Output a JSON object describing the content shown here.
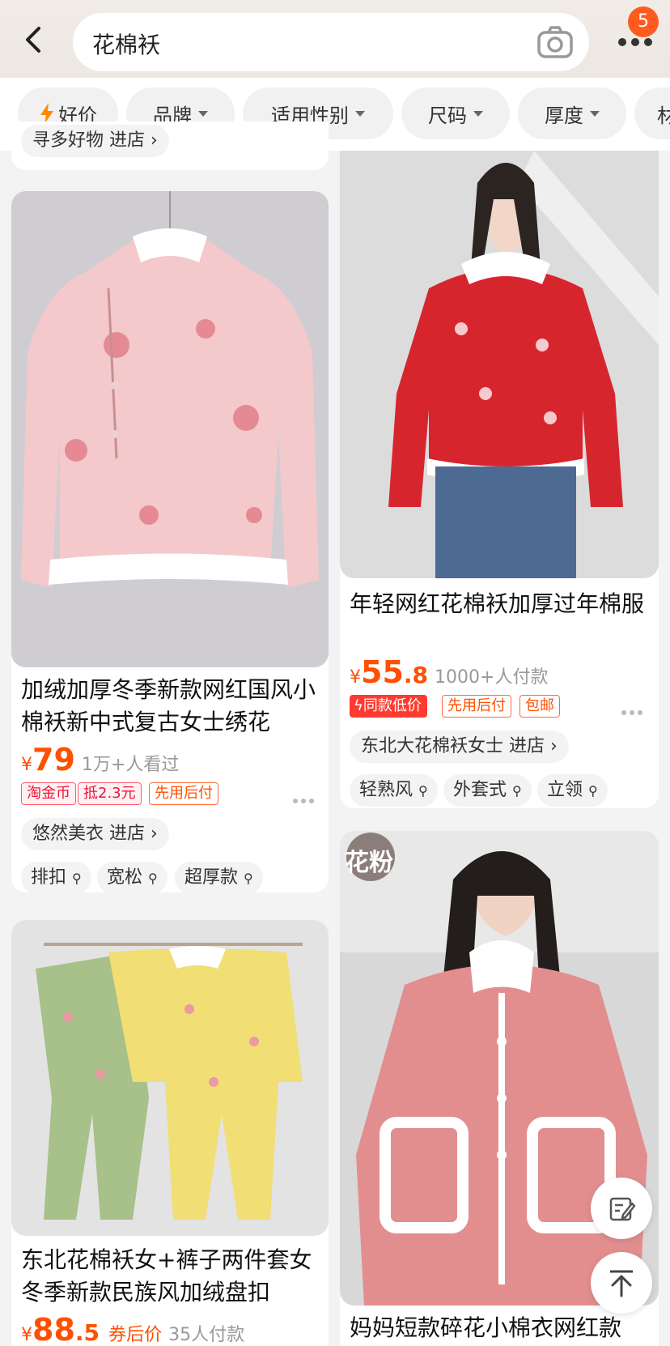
{
  "search": {
    "query": "花棉袄",
    "badge_count": "5"
  },
  "filters": [
    {
      "label": "好价",
      "has_bolt": true
    },
    {
      "label": "品牌",
      "has_caret": true
    },
    {
      "label": "适用性别",
      "has_caret": true
    },
    {
      "label": "尺码",
      "has_caret": true
    },
    {
      "label": "厚度",
      "has_caret": true
    },
    {
      "label": "材"
    }
  ],
  "top_partial_shop": "寻多好物 进店 ›",
  "products": [
    {
      "title": "加绒加厚冬季新款网红国风小棉袄新中式复古女士绣花",
      "yen": "¥",
      "price_int": "79",
      "price_dec": "",
      "stat": "1万+人看过",
      "tags": [
        "淘金币",
        "抵2.3元",
        "先用后付"
      ],
      "shop": "悠然美衣 进店 ›",
      "keywords": [
        "排扣",
        "宽松",
        "超厚款"
      ]
    },
    {
      "title": "年轻网红花棉袄加厚过年棉服",
      "yen": "¥",
      "price_int": "55",
      "price_dec": ".8",
      "stat": "1000+人付款",
      "tags": [
        "同款低价",
        "先用后付",
        "包邮"
      ],
      "shop": "东北大花棉袄女士 进店 ›",
      "keywords": [
        "轻熟风",
        "外套式",
        "立领"
      ]
    },
    {
      "title": "东北花棉袄女+裤子两件套女冬季新款民族风加绒盘扣",
      "yen": "¥",
      "price_int": "88",
      "price_dec": ".5",
      "price_label": "券后价",
      "stat": "35人付款"
    },
    {
      "title": "妈妈短款碎花小棉衣网红款",
      "overlay_text": "花粉"
    }
  ],
  "colors": {
    "accent": "#ff4f00",
    "badge": "#ff5a1f",
    "background": "#f3f3f3"
  }
}
